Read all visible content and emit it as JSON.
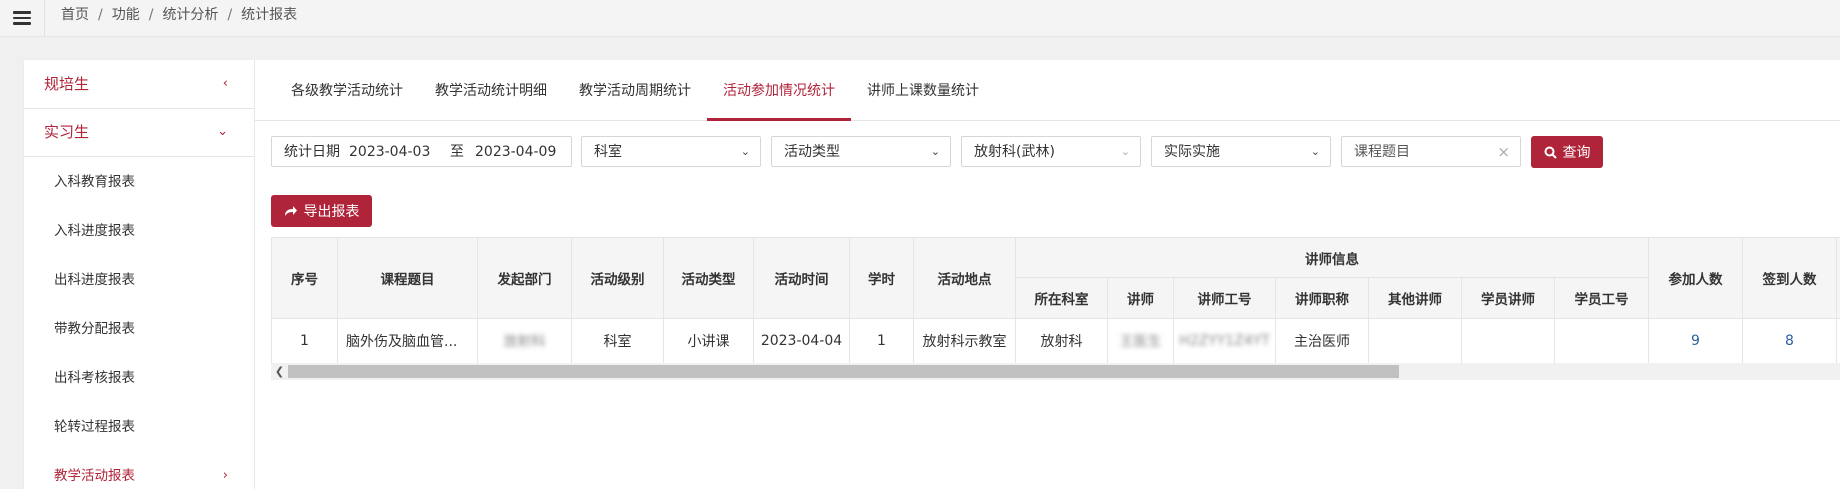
{
  "breadcrumb": [
    "首页",
    "功能",
    "统计分析",
    "统计报表"
  ],
  "breadcrumb_sep": "/",
  "sidebar": {
    "groups": [
      {
        "label": "规培生",
        "arrow": "‹"
      },
      {
        "label": "实习生",
        "arrow": "⌄"
      }
    ],
    "items": [
      {
        "label": "入科教育报表"
      },
      {
        "label": "入科进度报表"
      },
      {
        "label": "出科进度报表"
      },
      {
        "label": "带教分配报表"
      },
      {
        "label": "出科考核报表"
      },
      {
        "label": "轮转过程报表"
      },
      {
        "label": "教学活动报表",
        "arrow": "›",
        "active": true
      }
    ]
  },
  "tabs": [
    {
      "label": "各级教学活动统计"
    },
    {
      "label": "教学活动统计明细"
    },
    {
      "label": "教学活动周期统计"
    },
    {
      "label": "活动参加情况统计",
      "active": true
    },
    {
      "label": "讲师上课数量统计"
    }
  ],
  "filters": {
    "date_label": "统计日期",
    "date_start": "2023-04-03",
    "date_to": "至",
    "date_end": "2023-04-09",
    "department": "科室",
    "activity_type": "活动类型",
    "dept_selected": "放射科(武林)",
    "implementation": "实际实施",
    "course_placeholder": "课程题目",
    "query_button": "查询",
    "export_button": "导出报表"
  },
  "table": {
    "headers": {
      "no": "序号",
      "course": "课程题目",
      "dept": "发起部门",
      "level": "活动级别",
      "type": "活动类型",
      "time": "活动时间",
      "hours": "学时",
      "place": "活动地点",
      "lecturer_group": "讲师信息",
      "lec_dept": "所在科室",
      "lec": "讲师",
      "lec_id": "讲师工号",
      "lec_title": "讲师职称",
      "other_lec": "其他讲师",
      "student_lec": "学员讲师",
      "student_id": "学员工号",
      "participants": "参加人数",
      "signed": "签到人数"
    },
    "rows": [
      {
        "no": "1",
        "course": "脑外伤及脑血管...",
        "dept": "放射科",
        "level": "科室",
        "type": "小讲课",
        "time": "2023-04-04",
        "hours": "1",
        "place": "放射科示教室",
        "lec_dept": "放射科",
        "lec": "王医生",
        "lec_id": "H2ZYY1Z4YT",
        "lec_title": "主治医师",
        "other_lec": "",
        "student_lec": "",
        "student_id": "",
        "participants": "9",
        "signed": "8"
      }
    ]
  },
  "icons": {
    "menu": "hamburger-icon",
    "export": "share-icon",
    "query": "search-icon",
    "clear": "close-icon",
    "scroll_left": "chevron-left-icon"
  },
  "colors": {
    "accent": "#b0243a",
    "link": "#2b5f9e"
  }
}
